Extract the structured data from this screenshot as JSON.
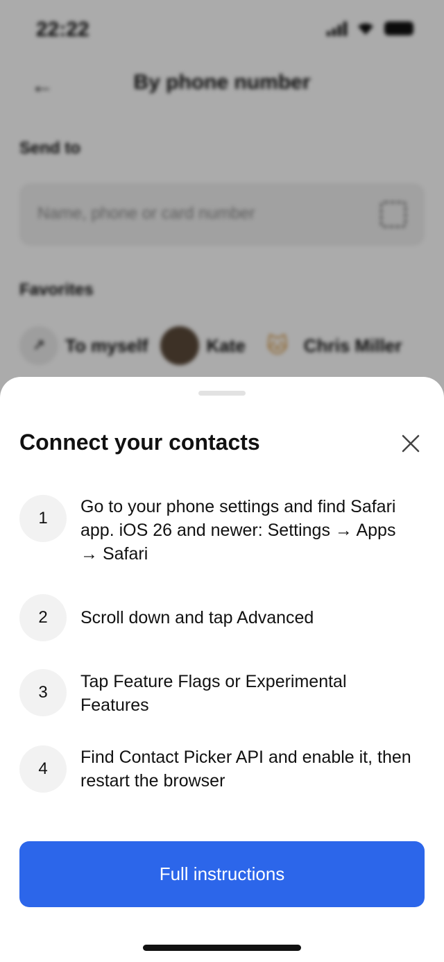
{
  "status_bar": {
    "time": "22:22",
    "icons": [
      "signal-icon",
      "wifi-icon",
      "battery-icon"
    ]
  },
  "background": {
    "title": "By phone number",
    "send_to_label": "Send to",
    "search_placeholder": "Name, phone or card number",
    "favorites_label": "Favorites",
    "favorites": [
      {
        "name": "To myself",
        "avatar": "arrow-icon"
      },
      {
        "name": "Kate",
        "avatar": "photo"
      },
      {
        "name": "Chris Miller",
        "avatar": "cat-icon"
      }
    ]
  },
  "sheet": {
    "title": "Connect your contacts",
    "steps": [
      {
        "number": "1",
        "text": "Go to your phone settings and find Safari app. iOS 26 and newer: Settings → Apps → Safari"
      },
      {
        "number": "2",
        "text": "Scroll down and tap Advanced"
      },
      {
        "number": "3",
        "text": "Tap Feature Flags or Experimental Features"
      },
      {
        "number": "4",
        "text": "Find Contact Picker API and enable it, then restart the browser"
      }
    ],
    "button_label": "Full instructions"
  },
  "colors": {
    "accent": "#2c66ea",
    "step_bg": "#f2f2f2",
    "overlay": "rgba(0,0,0,0.33)"
  }
}
